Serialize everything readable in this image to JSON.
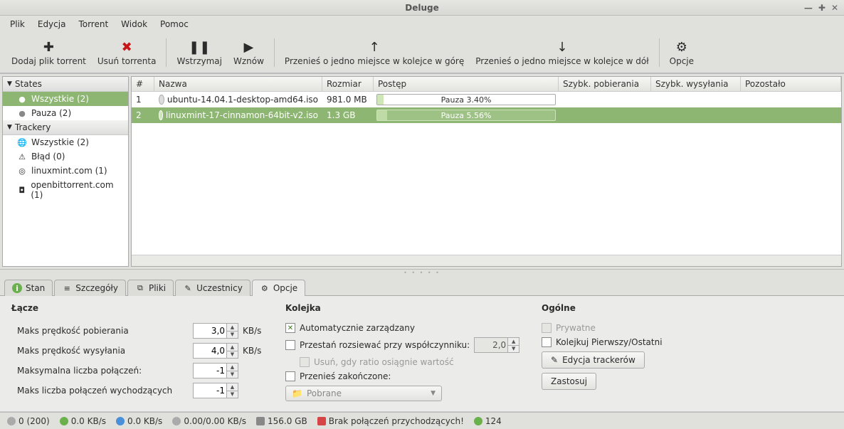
{
  "window": {
    "title": "Deluge"
  },
  "menu": [
    "Plik",
    "Edycja",
    "Torrent",
    "Widok",
    "Pomoc"
  ],
  "toolbar": [
    {
      "id": "add",
      "label": "Dodaj plik torrent",
      "glyph": "✚"
    },
    {
      "id": "remove",
      "label": "Usuń torrenta",
      "glyph": "✖",
      "red": true
    },
    {
      "sep": true
    },
    {
      "id": "pause",
      "label": "Wstrzymaj",
      "glyph": "❚❚"
    },
    {
      "id": "resume",
      "label": "Wznów",
      "glyph": "▶"
    },
    {
      "sep": true
    },
    {
      "id": "queue-up",
      "label": "Przenieś o jedno miejsce w kolejce w górę",
      "glyph": "↑"
    },
    {
      "id": "queue-down",
      "label": "Przenieś o jedno miejsce w kolejce w dół",
      "glyph": "↓"
    },
    {
      "sep": true
    },
    {
      "id": "prefs",
      "label": "Opcje",
      "glyph": "⚙"
    }
  ],
  "sidebar": {
    "states": {
      "header": "States",
      "items": [
        {
          "id": "all",
          "label": "Wszystkie (2)",
          "color": "",
          "selected": true
        },
        {
          "id": "paused",
          "label": "Pauza (2)",
          "color": "#888"
        }
      ]
    },
    "trackers": {
      "header": "Trackery",
      "items": [
        {
          "id": "all-trackers",
          "label": "Wszystkie (2)",
          "icon": "🌐"
        },
        {
          "id": "error",
          "label": "Błąd (0)",
          "icon": "⚠"
        },
        {
          "id": "linuxmint",
          "label": "linuxmint.com (1)",
          "icon": "◎"
        },
        {
          "id": "openbt",
          "label": "openbittorrent.com (1)",
          "icon": "◘"
        }
      ]
    }
  },
  "columns": {
    "num": "#",
    "name": "Nazwa",
    "size": "Rozmiar",
    "progress": "Postęp",
    "dl": "Szybk. pobierania",
    "ul": "Szybk. wysyłania",
    "eta": "Pozostało"
  },
  "torrents": [
    {
      "num": "1",
      "name": "ubuntu-14.04.1-desktop-amd64.iso",
      "size": "981.0 MB",
      "progress_text": "Pauza 3.40%",
      "progress_pct": 3.4,
      "selected": false
    },
    {
      "num": "2",
      "name": "linuxmint-17-cinnamon-64bit-v2.iso",
      "size": "1.3 GB",
      "progress_text": "Pauza 5.56%",
      "progress_pct": 5.56,
      "selected": true
    }
  ],
  "tabs": [
    {
      "id": "status",
      "label": "Stan"
    },
    {
      "id": "details",
      "label": "Szczegóły"
    },
    {
      "id": "files",
      "label": "Pliki"
    },
    {
      "id": "peers",
      "label": "Uczestnicy"
    },
    {
      "id": "options",
      "label": "Opcje",
      "active": true
    }
  ],
  "options": {
    "bandwidth_header": "Łącze",
    "max_dl_label": "Maks prędkość pobierania",
    "max_dl_value": "3,0",
    "max_ul_label": "Maks prędkość wysyłania",
    "max_ul_value": "4,0",
    "unit": "KB/s",
    "max_conn_label": "Maksymalna liczba połączeń:",
    "max_conn_value": "-1",
    "max_out_label": "Maks liczba połączeń wychodzących",
    "max_out_value": "-1",
    "queue_header": "Kolejka",
    "auto_managed": "Automatycznie zarządzany",
    "stop_ratio": "Przestań rozsiewać przy współczynniku:",
    "stop_ratio_value": "2,0",
    "remove_ratio": "Usuń, gdy ratio osiągnie wartość",
    "move_completed": "Przenieś zakończone:",
    "move_completed_path": "Pobrane",
    "general_header": "Ogólne",
    "private": "Prywatne",
    "first_last": "Kolejkuj Pierwszy/Ostatni",
    "edit_trackers": "Edycja trackerów",
    "apply": "Zastosuj"
  },
  "statusbar": {
    "conn": "0 (200)",
    "dl": "0.0 KB/s",
    "ul": "0.0 KB/s",
    "proto": "0.00/0.00 KB/s",
    "disk": "156.0 GB",
    "inbound": "Brak połączeń przychodzących!",
    "dht": "124"
  }
}
